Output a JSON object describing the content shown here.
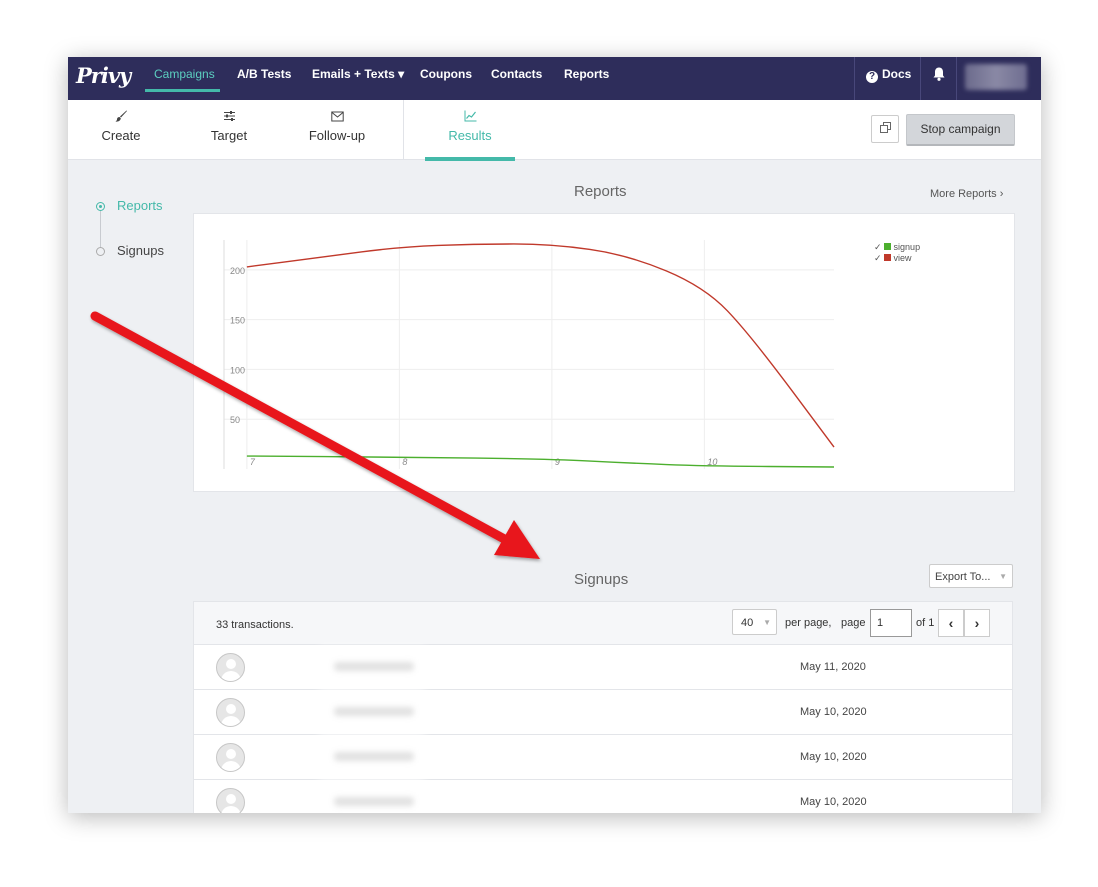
{
  "topnav": {
    "logo": "Privy",
    "items": [
      "Campaigns",
      "A/B Tests",
      "Emails + Texts ▾",
      "Coupons",
      "Contacts",
      "Reports"
    ],
    "active": "Campaigns",
    "docs_label": "Docs"
  },
  "subnav": {
    "steps": [
      {
        "label": "Create",
        "icon": "brush-icon"
      },
      {
        "label": "Target",
        "icon": "sliders-icon"
      },
      {
        "label": "Follow-up",
        "icon": "envelope-icon"
      },
      {
        "label": "Results",
        "icon": "line-chart-icon"
      }
    ],
    "active": "Results",
    "stop_label": "Stop campaign"
  },
  "sidebar": {
    "items": [
      {
        "label": "Reports",
        "active": true
      },
      {
        "label": "Signups",
        "active": false
      }
    ]
  },
  "reports": {
    "title": "Reports",
    "more_label": "More Reports ›"
  },
  "chart_data": {
    "type": "line",
    "x_ticks": [
      "7",
      "8",
      "9",
      "10"
    ],
    "y_ticks": [
      "50",
      "100",
      "150",
      "200"
    ],
    "ylim": [
      0,
      230
    ],
    "series": [
      {
        "name": "view",
        "color": "#c0392b",
        "x": [
          7,
          7.5,
          8,
          8.5,
          9,
          9.5,
          10,
          10.3,
          10.85
        ],
        "y": [
          203,
          213,
          223,
          226,
          226,
          215,
          183,
          135,
          22
        ]
      },
      {
        "name": "signup",
        "color": "#4caf2e",
        "x": [
          7,
          8,
          9,
          9.5,
          10,
          10.85
        ],
        "y": [
          13,
          12,
          10,
          6,
          3,
          2
        ]
      }
    ],
    "legend": [
      "signup",
      "view"
    ],
    "legend_position": "top-right",
    "grid": true
  },
  "signups": {
    "title": "Signups",
    "export_label": "Export To...",
    "count_label": "33 transactions.",
    "per_page_value": "40",
    "per_page_label": "per page,",
    "page_label": "page",
    "page_value": "1",
    "of_label": "of 1",
    "rows": [
      {
        "date": "May 11, 2020"
      },
      {
        "date": "May 10, 2020"
      },
      {
        "date": "May 10, 2020"
      },
      {
        "date": "May 10, 2020"
      }
    ]
  },
  "colors": {
    "nav_bg": "#2e2d5b",
    "accent": "#44b9a9",
    "view_line": "#c0392b",
    "signup_line": "#4caf2e",
    "arrow": "#e8141b"
  }
}
